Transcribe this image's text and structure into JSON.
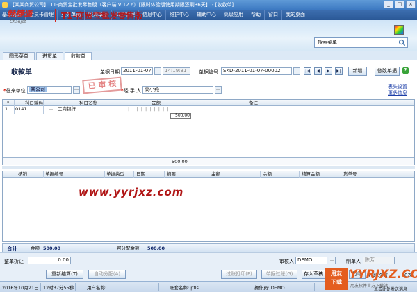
{
  "window": {
    "title": "【某某商贸公司】 T1-商贸宝批发零售版（客户端 V 12.6）【限时体验版使用期限还剩36天】 - [收款单]",
    "controls": [
      "_",
      "□",
      "×"
    ]
  },
  "menu": [
    "基本信息",
    "会员卡管理",
    "业务单据",
    "钱流单据",
    "财务管理",
    "信息中心",
    "维护中心",
    "辅助中心",
    "高级应用",
    "帮助",
    "窗口",
    "我的桌面"
  ],
  "header": {
    "logo": "畅捷通",
    "logo_sub": "Chanjet",
    "product": "T1-商贸宝批发零售版",
    "search_placeholder": "搜索菜单"
  },
  "tabs": [
    "图形菜单",
    "进货单",
    "收款单"
  ],
  "form": {
    "title": "收款单",
    "date_label": "单据日期",
    "date": "2011-01-07",
    "time": "14:19:31",
    "docno_label": "单据编号",
    "docno": "SKD-2011-01-07-00002",
    "nav": [
      "|◀",
      "◀",
      "▶",
      "▶|"
    ],
    "new_btn": "新增",
    "edit_btn": "修改单据",
    "help": "?",
    "party_label": "往来单位",
    "party": "某公司",
    "handler_label": "经 手 人",
    "handler": "高小燕",
    "stamp": "已 审 核",
    "link_header": "表头设置",
    "link_info": "更多信息",
    "ellipsis": "…"
  },
  "grid1": {
    "columns": [
      "",
      "科目编码",
      "科目名称",
      "金额",
      "备注"
    ],
    "rows": [
      {
        "num": "1",
        "code": "0141",
        "name": "工商银行",
        "amount": "500.00",
        "note": ""
      }
    ],
    "footer_amount": "500.00",
    "star": "*"
  },
  "grid2": {
    "columns": [
      "核销",
      "单据编号",
      "单据类型",
      "日期",
      "摘要",
      "金额",
      "余额",
      "结算金额",
      "货单号"
    ]
  },
  "watermark": "www.yyrjxz.com",
  "totals": {
    "label": "合计",
    "amount_label": "金额",
    "amount": "500.00",
    "alloc_label": "可分配金额",
    "alloc": "500.00"
  },
  "bottom": {
    "discount_label": "整单折让",
    "discount": "0.00",
    "reviewer_label": "审核人",
    "reviewer": "DEMO",
    "maker_label": "制单人",
    "maker": "陈芳",
    "btn_resettle": "重新结算(T)",
    "btn_autoalloc": "自动分配(A)",
    "btn_print_view": "过账打印(F)",
    "btn_post": "单据过账(G)",
    "btn_save_draft": "存入草稿",
    "btn_print": "打印",
    "print_count_label": "打印次数",
    "print_count": "0次"
  },
  "status": {
    "date": "2016年10月21日",
    "time": "12时37分55秒",
    "user_label": "用户名称:",
    "account": "账套名称: pfls",
    "operator": "操作员: DEMO",
    "tail": "点击此处发送消息"
  },
  "badge": {
    "a": "用友",
    "b": "下载",
    "site": "YYRJXZ.COM",
    "sub": "用友软件官方下载站"
  }
}
